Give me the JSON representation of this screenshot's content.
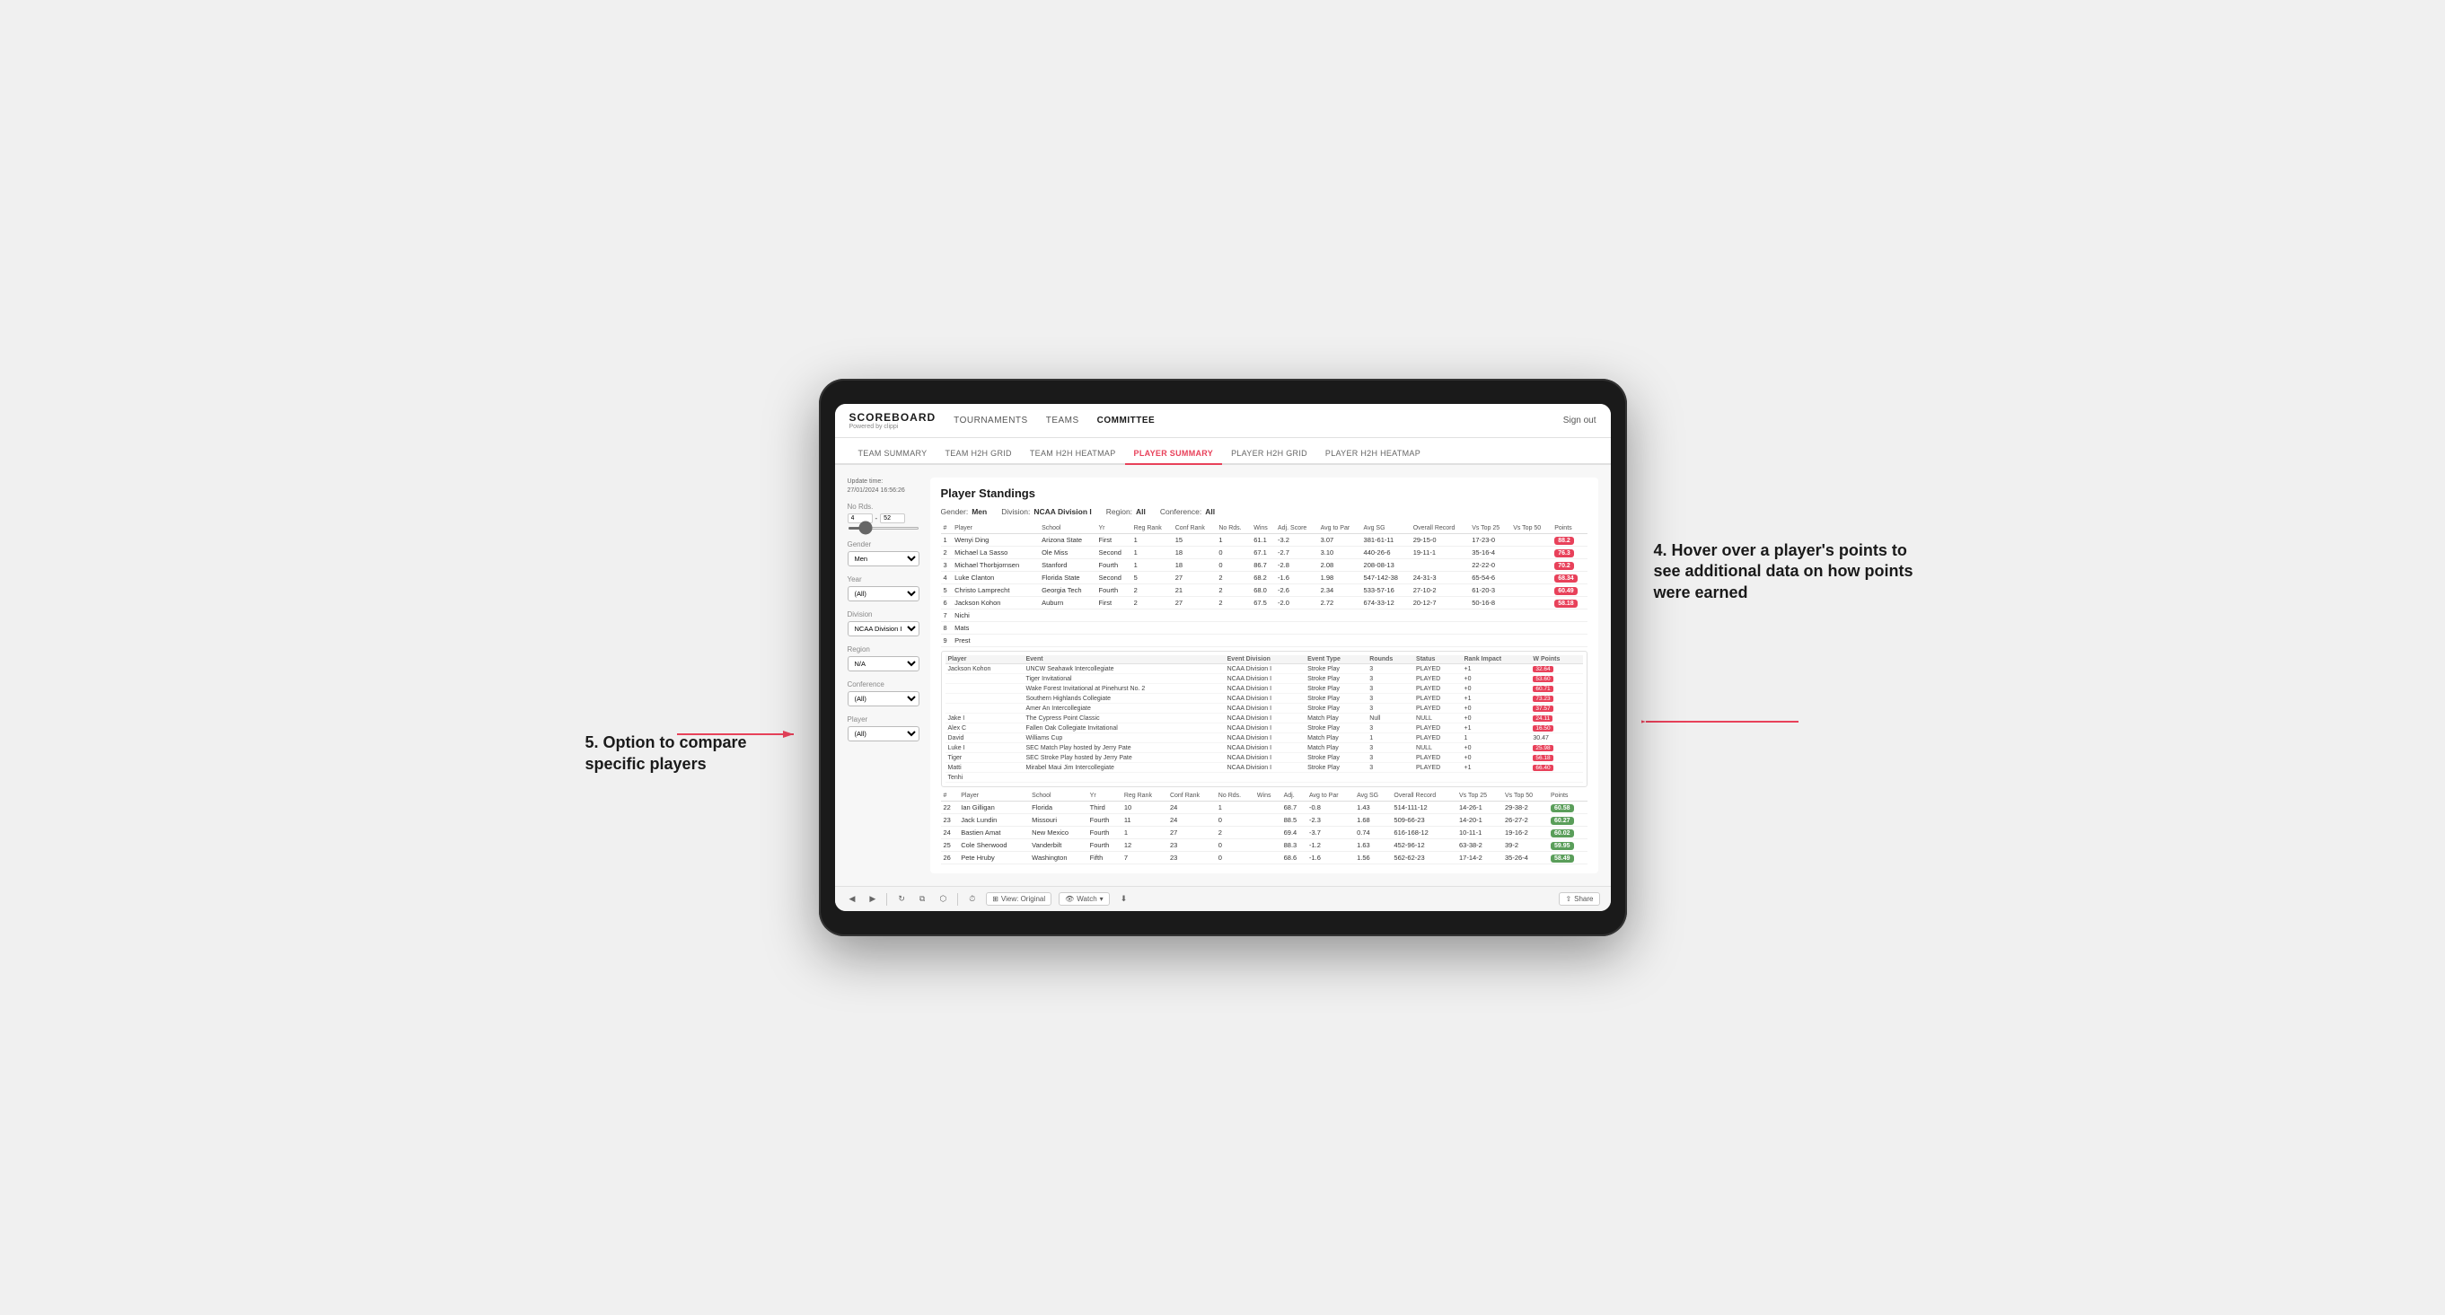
{
  "app": {
    "logo": "SCOREBOARD",
    "logo_sub": "Powered by clippi",
    "nav_items": [
      "TOURNAMENTS",
      "TEAMS",
      "COMMITTEE"
    ],
    "sign_out": "Sign out",
    "sub_nav": [
      "TEAM SUMMARY",
      "TEAM H2H GRID",
      "TEAM H2H HEATMAP",
      "PLAYER SUMMARY",
      "PLAYER H2H GRID",
      "PLAYER H2H HEATMAP"
    ],
    "active_sub": "PLAYER SUMMARY"
  },
  "sidebar": {
    "update_time_label": "Update time:",
    "update_time_value": "27/01/2024 16:56:26",
    "no_rds_label": "No Rds.",
    "no_rds_min": "4",
    "no_rds_max": "52",
    "gender_label": "Gender",
    "gender_value": "Men",
    "year_label": "Year",
    "year_value": "(All)",
    "division_label": "Division",
    "division_value": "NCAA Division I",
    "region_label": "Region",
    "region_value": "N/A",
    "conference_label": "Conference",
    "conference_value": "(All)",
    "player_label": "Player",
    "player_value": "(All)"
  },
  "standings": {
    "title": "Player Standings",
    "filters": {
      "gender_label": "Gender:",
      "gender_value": "Men",
      "division_label": "Division:",
      "division_value": "NCAA Division I",
      "region_label": "Region:",
      "region_value": "All",
      "conference_label": "Conference:",
      "conference_value": "All"
    },
    "columns": [
      "#",
      "Player",
      "School",
      "Yr",
      "Reg Rank",
      "Conf Rank",
      "No Rds.",
      "Wins",
      "Adj. Score",
      "Avg to Par",
      "Avg SG",
      "Overall Record",
      "Vs Top 25",
      "Vs Top 50",
      "Points"
    ],
    "rows": [
      {
        "num": "1",
        "player": "Wenyi Ding",
        "school": "Arizona State",
        "yr": "First",
        "reg_rank": "1",
        "conf_rank": "15",
        "no_rds": "1",
        "wins": "61.1",
        "adj_score": "-3.2",
        "avg_to_par": "3.07",
        "avg_sg": "381-61-11",
        "overall": "29-15-0",
        "vs25": "17-23-0",
        "vs50": "",
        "points": "88.2",
        "points_color": "red"
      },
      {
        "num": "2",
        "player": "Michael La Sasso",
        "school": "Ole Miss",
        "yr": "Second",
        "reg_rank": "1",
        "conf_rank": "18",
        "no_rds": "0",
        "wins": "67.1",
        "adj_score": "-2.7",
        "avg_to_par": "3.10",
        "avg_sg": "440-26-6",
        "overall": "19-11-1",
        "vs25": "35-16-4",
        "vs50": "",
        "points": "76.3",
        "points_color": "red"
      },
      {
        "num": "3",
        "player": "Michael Thorbjornsen",
        "school": "Stanford",
        "yr": "Fourth",
        "reg_rank": "1",
        "conf_rank": "18",
        "no_rds": "0",
        "wins": "86.7",
        "adj_score": "-2.8",
        "avg_to_par": "2.08-08-13",
        "overall": "",
        "vs25": "22-22-0",
        "vs50": "",
        "points": "70.2",
        "points_color": "red"
      },
      {
        "num": "4",
        "player": "Luke Clanton",
        "school": "Florida State",
        "yr": "Second",
        "reg_rank": "5",
        "conf_rank": "27",
        "no_rds": "2",
        "wins": "68.2",
        "adj_score": "-1.6",
        "avg_to_par": "1.98",
        "avg_sg": "547-142-38",
        "overall": "24-31-3",
        "vs25": "65-54-6",
        "vs50": "",
        "points": "68.34",
        "points_color": "red"
      },
      {
        "num": "5",
        "player": "Christo Lamprecht",
        "school": "Georgia Tech",
        "yr": "Fourth",
        "reg_rank": "2",
        "conf_rank": "21",
        "no_rds": "2",
        "wins": "68.0",
        "adj_score": "-2.6",
        "avg_to_par": "2.34",
        "avg_sg": "533-57-16",
        "overall": "27-10-2",
        "vs25": "61-20-3",
        "vs50": "",
        "points": "60.49",
        "points_color": "red"
      },
      {
        "num": "6",
        "player": "Jackson Kohon",
        "school": "Auburn",
        "yr": "First",
        "reg_rank": "2",
        "conf_rank": "27",
        "no_rds": "2",
        "wins": "67.5",
        "adj_score": "-2.0",
        "avg_to_par": "2.72",
        "avg_sg": "674-33-12",
        "overall": "20-12-7",
        "vs25": "50-16-8",
        "vs50": "",
        "points": "58.18",
        "points_color": "red"
      },
      {
        "num": "7",
        "player": "Nichi",
        "school": "",
        "yr": "",
        "reg_rank": "",
        "conf_rank": "",
        "no_rds": "",
        "wins": "",
        "adj_score": "",
        "avg_to_par": "",
        "avg_sg": "",
        "overall": "",
        "vs25": "",
        "vs50": "",
        "points": "",
        "points_color": ""
      },
      {
        "num": "8",
        "player": "Mats",
        "school": "",
        "yr": "",
        "reg_rank": "",
        "conf_rank": "",
        "no_rds": "",
        "wins": "",
        "adj_score": "",
        "avg_to_par": "",
        "avg_sg": "",
        "overall": "",
        "vs25": "",
        "vs50": "",
        "points": "",
        "points_color": ""
      },
      {
        "num": "9",
        "player": "Prest",
        "school": "",
        "yr": "",
        "reg_rank": "",
        "conf_rank": "",
        "no_rds": "",
        "wins": "",
        "adj_score": "",
        "avg_to_par": "",
        "avg_sg": "",
        "overall": "",
        "vs25": "",
        "vs50": "",
        "points": "",
        "points_color": ""
      }
    ],
    "detail_player": "Jackson Kohon",
    "detail_columns": [
      "Player",
      "Event",
      "Event Division",
      "Event Type",
      "Rounds",
      "Status",
      "Rank Impact",
      "W Points"
    ],
    "detail_rows": [
      {
        "player": "Jackson Kohon",
        "event": "UNCW Seahawk Intercollegiate",
        "division": "NCAA Division I",
        "type": "Stroke Play",
        "rounds": "3",
        "status": "PLAYED",
        "impact": "+1",
        "wpoints": "32.64",
        "wpoints_color": "red"
      },
      {
        "player": "",
        "event": "Tiger Invitational",
        "division": "NCAA Division I",
        "type": "Stroke Play",
        "rounds": "3",
        "status": "PLAYED",
        "impact": "+0",
        "wpoints": "53.60",
        "wpoints_color": "red"
      },
      {
        "player": "",
        "event": "Wake Forest Invitational at Pinehurst No. 2",
        "division": "NCAA Division I",
        "type": "Stroke Play",
        "rounds": "3",
        "status": "PLAYED",
        "impact": "+0",
        "wpoints": "60.71",
        "wpoints_color": "red"
      },
      {
        "player": "",
        "event": "Southern Highlands Collegiate",
        "division": "NCAA Division I",
        "type": "Stroke Play",
        "rounds": "3",
        "status": "PLAYED",
        "impact": "+1",
        "wpoints": "73.23",
        "wpoints_color": "red"
      },
      {
        "player": "",
        "event": "Amer An Intercollegiate",
        "division": "NCAA Division I",
        "type": "Stroke Play",
        "rounds": "3",
        "status": "PLAYED",
        "impact": "+0",
        "wpoints": "37.57",
        "wpoints_color": "red"
      },
      {
        "player": "Jake I",
        "event": "The Cypress Point Classic",
        "division": "NCAA Division I",
        "type": "Match Play",
        "rounds": "Null",
        "status": "NULL",
        "impact": "+0",
        "wpoints": "24.11",
        "wpoints_color": "red"
      },
      {
        "player": "Alex C",
        "event": "Fallen Oak Collegiate Invitational",
        "division": "NCAA Division I",
        "type": "Stroke Play",
        "rounds": "3",
        "status": "PLAYED",
        "impact": "+1",
        "wpoints": "16.50",
        "wpoints_color": "red"
      },
      {
        "player": "David",
        "event": "Williams Cup",
        "division": "NCAA Division I",
        "type": "Match Play",
        "rounds": "1",
        "status": "PLAYED",
        "impact": "1",
        "wpoints": "30.47",
        "wpoints_color": ""
      },
      {
        "player": "Luke I",
        "event": "SEC Match Play hosted by Jerry Pate",
        "division": "NCAA Division I",
        "type": "Match Play",
        "rounds": "3",
        "status": "NULL",
        "impact": "+0",
        "wpoints": "25.98",
        "wpoints_color": "red"
      },
      {
        "player": "Tiger",
        "event": "SEC Stroke Play hosted by Jerry Pate",
        "division": "NCAA Division I",
        "type": "Stroke Play",
        "rounds": "3",
        "status": "PLAYED",
        "impact": "+0",
        "wpoints": "56.18",
        "wpoints_color": "red"
      },
      {
        "player": "Matti",
        "event": "Mirabel Maui Jim Intercollegiate",
        "division": "NCAA Division I",
        "type": "Stroke Play",
        "rounds": "3",
        "status": "PLAYED",
        "impact": "+1",
        "wpoints": "66.40",
        "wpoints_color": "red"
      },
      {
        "player": "Tenhi",
        "school": "",
        "event": "",
        "division": "",
        "type": "",
        "rounds": "",
        "status": "",
        "impact": "",
        "wpoints": "",
        "wpoints_color": ""
      },
      {
        "player": "Ian Gilligan",
        "event": "Florida",
        "division": "Third",
        "type": "10",
        "rounds": "24",
        "status": "1",
        "impact": "68.7",
        "wpoints": "-0.8"
      },
      {
        "player": "Jack Lundin",
        "event": "Missouri",
        "division": "Fourth",
        "type": "11",
        "rounds": "24",
        "status": "0",
        "impact": "88.5",
        "wpoints": "-2.3"
      },
      {
        "player": "Bastien Amat",
        "event": "New Mexico",
        "division": "Fourth",
        "type": "1",
        "rounds": "27",
        "status": "2",
        "impact": "69.4",
        "wpoints": "-3.7"
      },
      {
        "player": "Cole Sherwood",
        "event": "Vanderbilt",
        "division": "Fourth",
        "type": "12",
        "rounds": "23",
        "status": "0",
        "impact": "88.3",
        "wpoints": "-1.2"
      },
      {
        "player": "Pete Hruby",
        "event": "Washington",
        "division": "Fifth",
        "type": "7",
        "rounds": "23",
        "status": "0",
        "impact": "68.6",
        "wpoints": "-1.6"
      }
    ]
  },
  "toolbar": {
    "back": "◀",
    "forward": "▶",
    "view_label": "View: Original",
    "watch_label": "Watch",
    "share_label": "Share"
  },
  "annotations": {
    "right_title": "4. Hover over a player's points to see additional data on how points were earned",
    "left_title": "5. Option to compare specific players"
  }
}
